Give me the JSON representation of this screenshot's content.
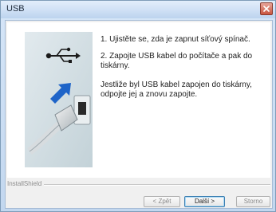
{
  "window": {
    "title": "USB",
    "close_icon": "close-icon",
    "close_color": "#c9553f"
  },
  "message": {
    "step1": "1. Ujistěte se, zda je zapnut síťový spínač.",
    "step2": "2. Zapojte USB kabel do počítače a pak do tiskárny.",
    "note": "Jestliže byl USB kabel zapojen do tiskárny, odpojte jej a znovu zapojte."
  },
  "artwork": {
    "usb_icon": "usb-symbol-icon",
    "arrow_icon": "blue-arrow-icon",
    "arrow_color": "#1e64c8"
  },
  "footer": {
    "brand": "InstallShield"
  },
  "buttons": {
    "back": "< Zpět",
    "next": "Další >",
    "cancel": "Storno"
  }
}
